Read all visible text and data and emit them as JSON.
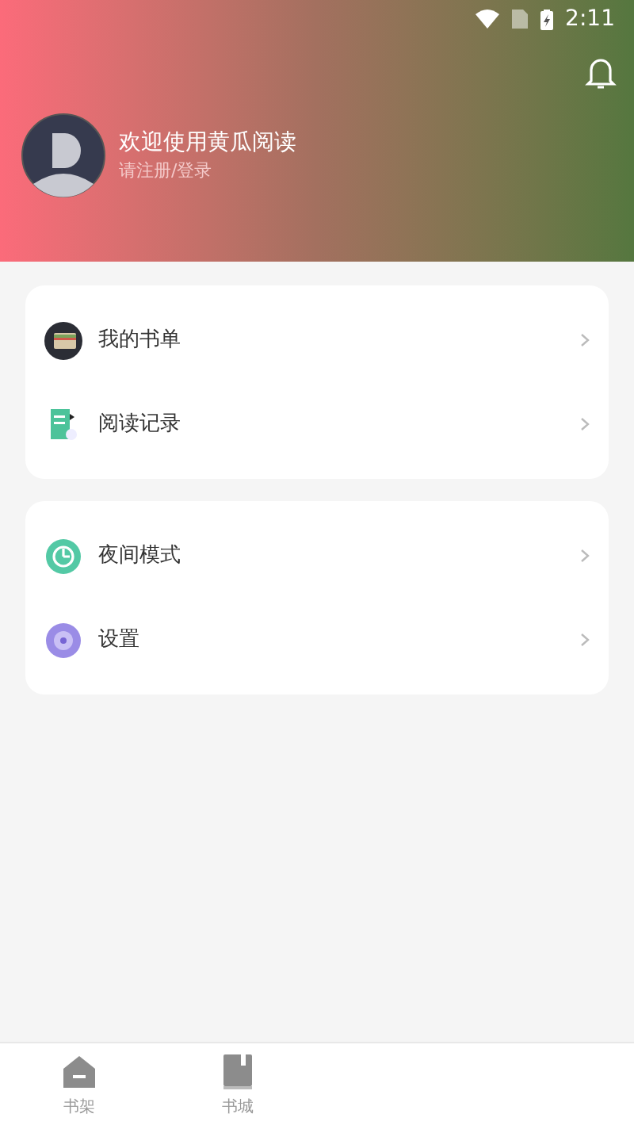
{
  "status_bar": {
    "time": "2:11"
  },
  "profile": {
    "title": "欢迎使用黄瓜阅读",
    "subtitle": "请注册/登录"
  },
  "menu_groups": [
    {
      "items": [
        {
          "label": "我的书单",
          "kind": "booklist"
        },
        {
          "label": "阅读记录",
          "kind": "history"
        }
      ]
    },
    {
      "items": [
        {
          "label": "夜间模式",
          "kind": "night"
        },
        {
          "label": "设置",
          "kind": "settings"
        }
      ]
    }
  ],
  "bottom_nav": [
    {
      "label": "书架",
      "kind": "shelf"
    },
    {
      "label": "书城",
      "kind": "store"
    }
  ]
}
